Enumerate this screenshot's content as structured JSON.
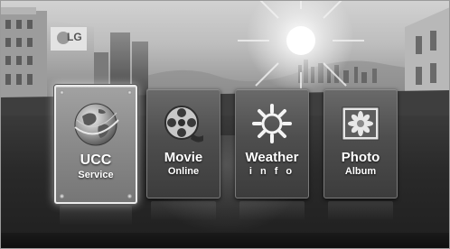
{
  "menu": {
    "items": [
      {
        "title": "UCC",
        "subtitle": "Service",
        "icon": "globe-icon",
        "selected": true
      },
      {
        "title": "Movie",
        "subtitle": "Online",
        "icon": "film-reel-icon",
        "selected": false
      },
      {
        "title": "Weather",
        "subtitle": "i n f o",
        "icon": "sun-icon",
        "selected": false
      },
      {
        "title": "Photo",
        "subtitle": "Album",
        "icon": "flower-photo-icon",
        "selected": false
      }
    ]
  },
  "background": {
    "billboard_logo": "LG"
  }
}
